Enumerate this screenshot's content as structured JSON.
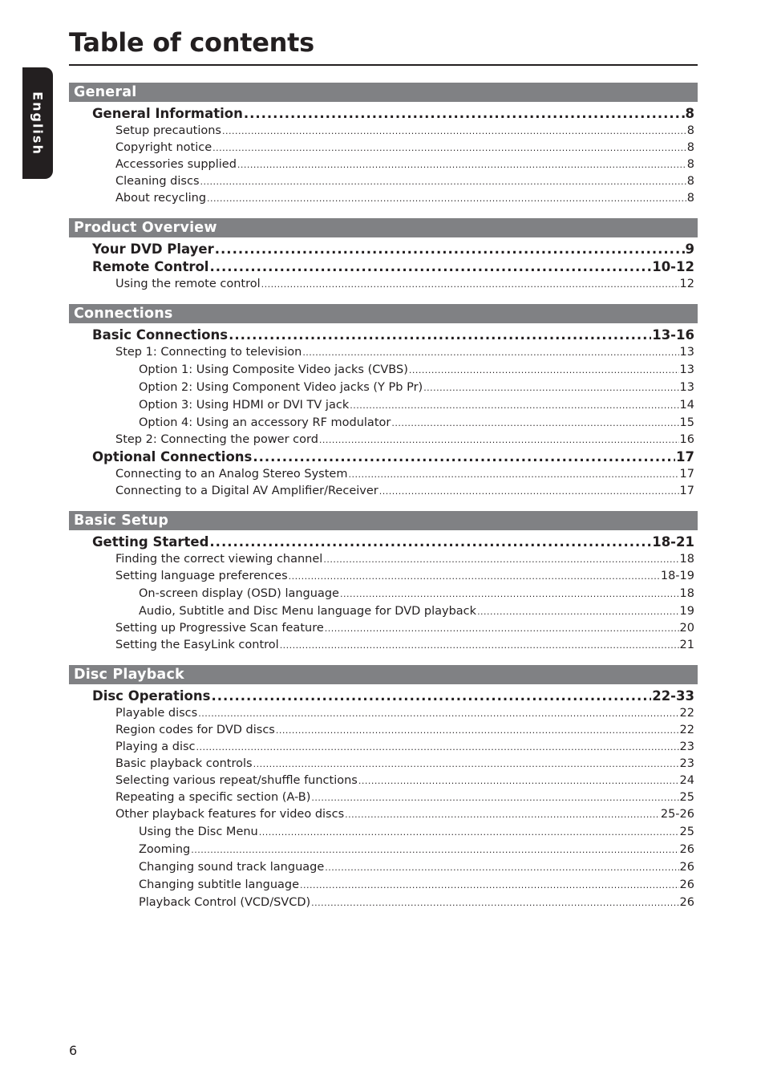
{
  "page": {
    "title": "Table of contents",
    "language_tab": "English",
    "page_number": "6"
  },
  "sections": [
    {
      "header": "General",
      "entries": [
        {
          "level": 1,
          "label": "General Information",
          "page": "8"
        },
        {
          "level": 2,
          "label": "Setup precautions",
          "page": "8"
        },
        {
          "level": 2,
          "label": "Copyright notice",
          "page": "8"
        },
        {
          "level": 2,
          "label": "Accessories supplied",
          "page": "8"
        },
        {
          "level": 2,
          "label": "Cleaning discs",
          "page": "8"
        },
        {
          "level": 2,
          "label": "About recycling",
          "page": "8"
        }
      ]
    },
    {
      "header": "Product Overview",
      "entries": [
        {
          "level": 1,
          "label": "Your DVD Player",
          "page": "9"
        },
        {
          "level": 1,
          "label": "Remote Control",
          "page": "10-12"
        },
        {
          "level": 2,
          "label": "Using the remote control",
          "page": "12"
        }
      ]
    },
    {
      "header": "Connections",
      "entries": [
        {
          "level": 1,
          "label": "Basic Connections",
          "page": "13-16"
        },
        {
          "level": 2,
          "label": "Step 1: Connecting to television",
          "page": "13"
        },
        {
          "level": 3,
          "label": "Option 1: Using Composite Video jacks (CVBS)",
          "page": "13"
        },
        {
          "level": 3,
          "label": "Option 2: Using Component Video jacks (Y Pb Pr)",
          "page": "13"
        },
        {
          "level": 3,
          "label": "Option 3: Using HDMI or DVI TV jack",
          "page": "14"
        },
        {
          "level": 3,
          "label": "Option 4: Using an accessory RF modulator",
          "page": "15"
        },
        {
          "level": 2,
          "label": "Step 2: Connecting the power cord",
          "page": "16"
        },
        {
          "level": 1,
          "label": "Optional Connections",
          "page": "17"
        },
        {
          "level": 2,
          "label": "Connecting to an Analog Stereo System",
          "page": "17"
        },
        {
          "level": 2,
          "label": "Connecting to a Digital AV Amplifier/Receiver",
          "page": "17"
        }
      ]
    },
    {
      "header": "Basic Setup",
      "entries": [
        {
          "level": 1,
          "label": "Getting Started",
          "page": "18-21"
        },
        {
          "level": 2,
          "label": "Finding the correct viewing channel",
          "page": "18"
        },
        {
          "level": 2,
          "label": "Setting language preferences",
          "page": "18-19"
        },
        {
          "level": 3,
          "label": "On-screen display (OSD) language",
          "page": "18"
        },
        {
          "level": 3,
          "label": "Audio, Subtitle and Disc Menu language for DVD playback",
          "page": "19"
        },
        {
          "level": 2,
          "label": "Setting up Progressive Scan feature",
          "page": "20"
        },
        {
          "level": 2,
          "label": "Setting the EasyLink control",
          "page": "21"
        }
      ]
    },
    {
      "header": "Disc Playback",
      "entries": [
        {
          "level": 1,
          "label": "Disc Operations",
          "page": "22-33"
        },
        {
          "level": 2,
          "label": "Playable discs",
          "page": "22"
        },
        {
          "level": 2,
          "label": "Region codes for DVD discs",
          "page": "22"
        },
        {
          "level": 2,
          "label": "Playing a disc",
          "page": "23"
        },
        {
          "level": 2,
          "label": "Basic playback controls",
          "page": "23"
        },
        {
          "level": 2,
          "label": "Selecting various repeat/shuffle functions",
          "page": "24"
        },
        {
          "level": 2,
          "label": "Repeating a specific section (A-B)",
          "page": "25"
        },
        {
          "level": 2,
          "label": "Other playback features for video discs",
          "page": "25-26"
        },
        {
          "level": 3,
          "label": "Using the Disc Menu",
          "page": "25"
        },
        {
          "level": 3,
          "label": "Zooming",
          "page": "26"
        },
        {
          "level": 3,
          "label": "Changing sound track language",
          "page": "26"
        },
        {
          "level": 3,
          "label": "Changing subtitle language",
          "page": "26"
        },
        {
          "level": 3,
          "label": "Playback Control (VCD/SVCD)",
          "page": "26"
        }
      ]
    }
  ]
}
